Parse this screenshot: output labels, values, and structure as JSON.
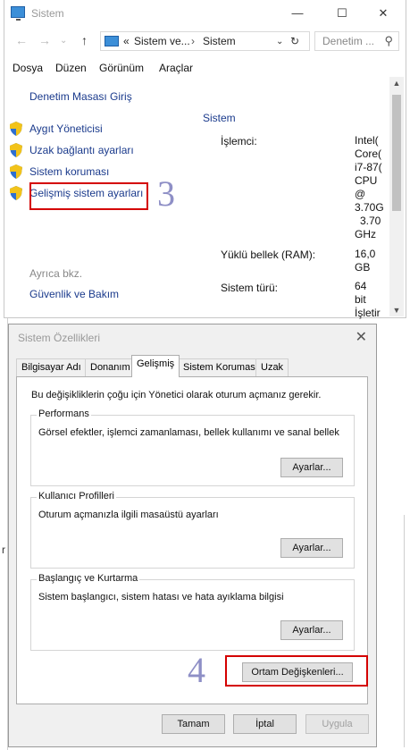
{
  "system_window": {
    "title": "Sistem",
    "breadcrumb_prefix": "«",
    "breadcrumb": [
      "Sistem ve...",
      "Sistem"
    ],
    "search_placeholder": "Denetim ...",
    "menu": [
      "Dosya",
      "Düzen",
      "Görünüm",
      "Araçlar"
    ],
    "control_panel_home": "Denetim Masası Giriş",
    "left_links": [
      "Aygıt Yöneticisi",
      "Uzak bağlantı ayarları",
      "Sistem koruması",
      "Gelişmiş sistem ayarları"
    ],
    "see_also": "Ayrıca bkz.",
    "security_link": "Güvenlik ve Bakım",
    "section_title": "Sistem",
    "processor_label": "İşlemci:",
    "processor_value": [
      "Intel(",
      "Core(",
      "i7-87(",
      "CPU",
      "@",
      "3.70G",
      "3.70",
      "GHz"
    ],
    "ram_label": "Yüklü bellek (RAM):",
    "ram_value": [
      "16,0",
      "GB"
    ],
    "type_label": "Sistem türü:",
    "type_value": [
      "64",
      "bit",
      "İşletir"
    ]
  },
  "annotations": {
    "step3": "3",
    "step4": "4"
  },
  "dialog": {
    "title": "Sistem Özellikleri",
    "tabs": [
      "Bilgisayar Adı",
      "Donanım",
      "Gelişmiş",
      "Sistem Koruması",
      "Uzak"
    ],
    "active_tab": "Gelişmiş",
    "intro": "Bu değişikliklerin çoğu için Yönetici olarak oturum açmanız gerekir.",
    "groups": [
      {
        "title": "Performans",
        "desc": "Görsel efektler, işlemci zamanlaması, bellek kullanımı ve sanal bellek",
        "button": "Ayarlar..."
      },
      {
        "title": "Kullanıcı Profilleri",
        "desc": "Oturum açmanızla ilgili masaüstü ayarları",
        "button": "Ayarlar..."
      },
      {
        "title": "Başlangıç ve Kurtarma",
        "desc": "Sistem başlangıcı, sistem hatası ve hata ayıklama bilgisi",
        "button": "Ayarlar..."
      }
    ],
    "env_button": "Ortam Değişkenleri...",
    "ok": "Tamam",
    "cancel": "İptal",
    "apply": "Uygula"
  },
  "background_text": "r"
}
